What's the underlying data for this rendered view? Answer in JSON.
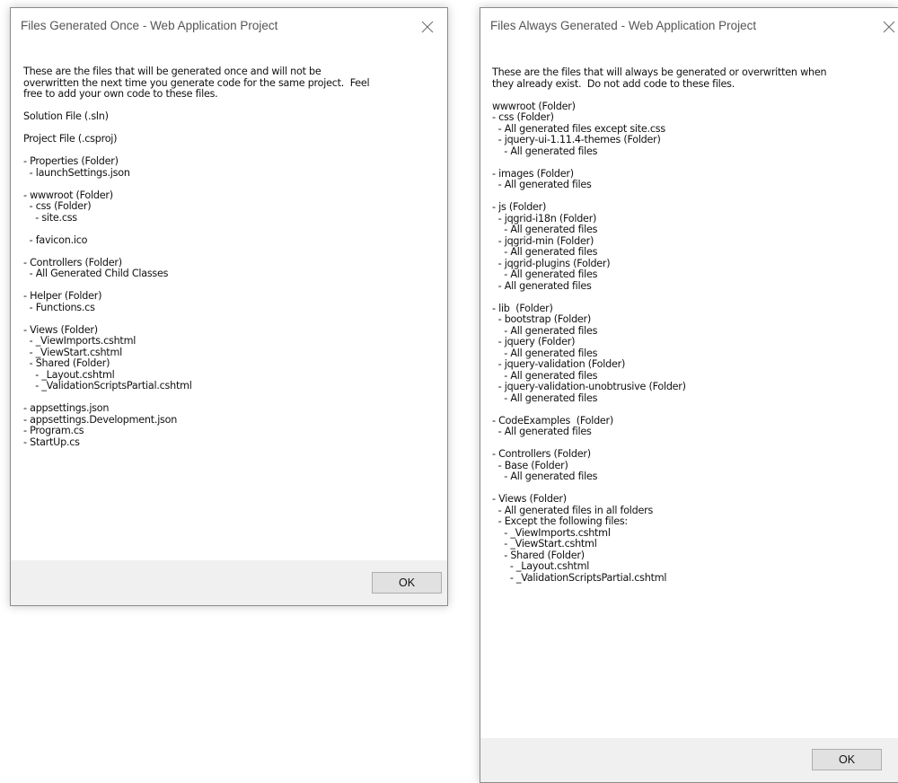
{
  "dialog_once": {
    "title": "Files Generated Once - Web Application Project",
    "body": "These are the files that will be generated once and will not be\noverwritten the next time you generate code for the same project.  Feel\nfree to add your own code to these files.\n\nSolution File (.sln)\n\nProject File (.csproj)\n\n- Properties (Folder)\n  - launchSettings.json\n\n- wwwroot (Folder)\n  - css (Folder)\n    - site.css\n\n  - favicon.ico\n\n- Controllers (Folder)\n  - All Generated Child Classes\n\n- Helper (Folder)\n  - Functions.cs\n\n- Views (Folder)\n  - _ViewImports.cshtml\n  - _ViewStart.cshtml\n  - Shared (Folder)\n    - _Layout.cshtml\n    - _ValidationScriptsPartial.cshtml\n\n- appsettings.json\n- appsettings.Development.json\n- Program.cs\n- StartUp.cs",
    "ok_label": "OK",
    "close_icon": "close-icon"
  },
  "dialog_always": {
    "title": "Files Always Generated - Web Application Project",
    "body": "These are the files that will always be generated or overwritten when\nthey already exist.  Do not add code to these files.\n\nwwwroot (Folder)\n- css (Folder)\n  - All generated files except site.css\n  - jquery-ui-1.11.4-themes (Folder)\n    - All generated files\n\n- images (Folder)\n  - All generated files\n\n- js (Folder)\n  - jqgrid-i18n (Folder)\n    - All generated files\n  - jqgrid-min (Folder)\n    - All generated files\n  - jqgrid-plugins (Folder)\n    - All generated files\n  - All generated files\n\n- lib  (Folder)\n  - bootstrap (Folder)\n    - All generated files\n  - jquery (Folder)\n    - All generated files\n  - jquery-validation (Folder)\n    - All generated files\n  - jquery-validation-unobtrusive (Folder)\n    - All generated files\n\n- CodeExamples  (Folder)\n  - All generated files\n\n- Controllers (Folder)\n  - Base (Folder)\n    - All generated files\n\n- Views (Folder)\n  - All generated files in all folders\n  - Except the following files:\n    - _ViewImports.cshtml\n    - _ViewStart.cshtml\n    - Shared (Folder)\n      - _Layout.cshtml\n      - _ValidationScriptsPartial.cshtml",
    "ok_label": "OK",
    "close_icon": "close-icon"
  },
  "colors": {
    "footer_bg": "#f0f0f0",
    "button_bg": "#e1e1e1",
    "button_border": "#adadad",
    "title_text": "#555555"
  }
}
